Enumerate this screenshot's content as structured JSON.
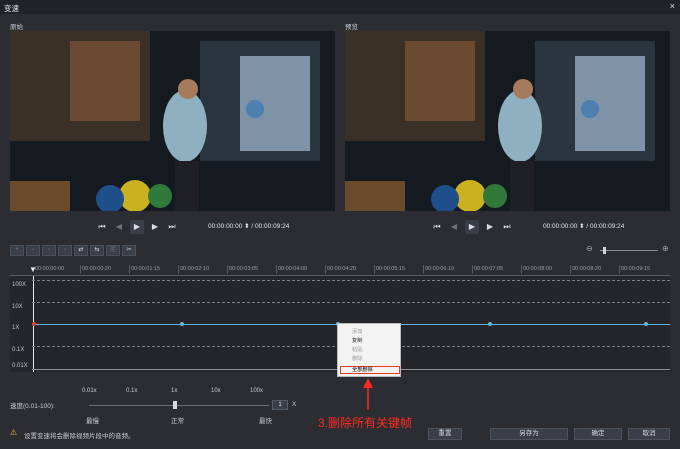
{
  "window": {
    "title": "变速",
    "close": "×"
  },
  "panels": {
    "original": "原始",
    "preview": "预览"
  },
  "player": {
    "timecode_left": "00:00:00:00",
    "timecode_right": "00:00:09:24"
  },
  "ruler": [
    "00:00:00:00",
    "00:00:00:20",
    "00:00:01:15",
    "00:00:02:10",
    "00:00:03:05",
    "00:00:04:00",
    "00:00:04:20",
    "00:00:05:15",
    "00:00:06:10",
    "00:00:07:05",
    "00:00:08:00",
    "00:00:08:20",
    "00:00:09:15"
  ],
  "graph": {
    "y": [
      "100X",
      "10X",
      "1X",
      "0.1X",
      "0.01X"
    ]
  },
  "context_menu": {
    "items": [
      "添加",
      "复制",
      "粘贴",
      "删除",
      "全部删除"
    ]
  },
  "speed": {
    "label": "速度(0.01-100):",
    "value": "1",
    "unit": "X",
    "scale": [
      "0.01x",
      "0.1x",
      "1x",
      "10x",
      "100x"
    ],
    "names": [
      "最慢",
      "正常",
      "最快"
    ]
  },
  "footer": {
    "warning": "设置变速将会删除视频片段中的音频。",
    "buttons": [
      "重置",
      "另存为",
      "确定",
      "取消"
    ]
  },
  "annotation": "3.删除所有关键帧",
  "colors": {
    "accent": "#5fb6e8",
    "annotation": "#ff2a1f"
  }
}
